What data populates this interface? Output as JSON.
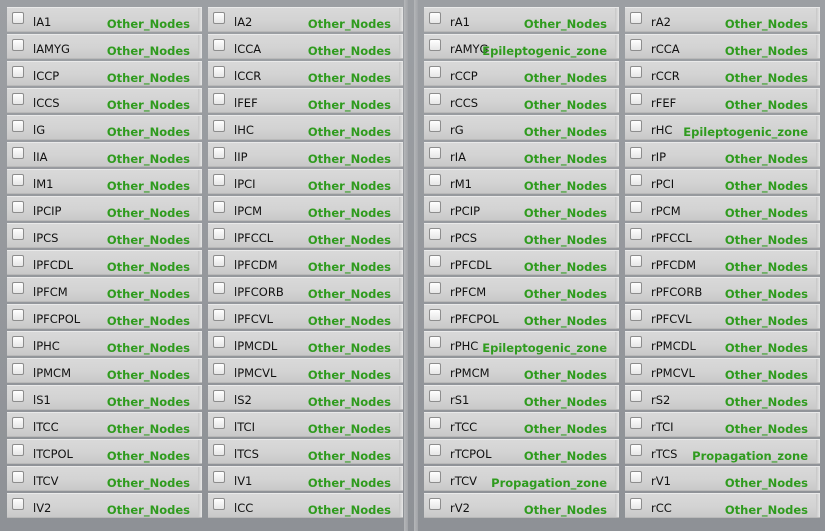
{
  "columns": [
    {
      "rows": [
        {
          "name": "lA1",
          "zone": "Other_Nodes"
        },
        {
          "name": "lAMYG",
          "zone": "Other_Nodes"
        },
        {
          "name": "lCCP",
          "zone": "Other_Nodes"
        },
        {
          "name": "lCCS",
          "zone": "Other_Nodes"
        },
        {
          "name": "lG",
          "zone": "Other_Nodes"
        },
        {
          "name": "lIA",
          "zone": "Other_Nodes"
        },
        {
          "name": "lM1",
          "zone": "Other_Nodes"
        },
        {
          "name": "lPCIP",
          "zone": "Other_Nodes"
        },
        {
          "name": "lPCS",
          "zone": "Other_Nodes"
        },
        {
          "name": "lPFCDL",
          "zone": "Other_Nodes"
        },
        {
          "name": "lPFCM",
          "zone": "Other_Nodes"
        },
        {
          "name": "lPFCPOL",
          "zone": "Other_Nodes"
        },
        {
          "name": "lPHC",
          "zone": "Other_Nodes"
        },
        {
          "name": "lPMCM",
          "zone": "Other_Nodes"
        },
        {
          "name": "lS1",
          "zone": "Other_Nodes"
        },
        {
          "name": "lTCC",
          "zone": "Other_Nodes"
        },
        {
          "name": "lTCPOL",
          "zone": "Other_Nodes"
        },
        {
          "name": "lTCV",
          "zone": "Other_Nodes"
        },
        {
          "name": "lV2",
          "zone": "Other_Nodes"
        }
      ]
    },
    {
      "rows": [
        {
          "name": "lA2",
          "zone": "Other_Nodes"
        },
        {
          "name": "lCCA",
          "zone": "Other_Nodes"
        },
        {
          "name": "lCCR",
          "zone": "Other_Nodes"
        },
        {
          "name": "lFEF",
          "zone": "Other_Nodes"
        },
        {
          "name": "lHC",
          "zone": "Other_Nodes"
        },
        {
          "name": "lIP",
          "zone": "Other_Nodes"
        },
        {
          "name": "lPCI",
          "zone": "Other_Nodes"
        },
        {
          "name": "lPCM",
          "zone": "Other_Nodes"
        },
        {
          "name": "lPFCCL",
          "zone": "Other_Nodes"
        },
        {
          "name": "lPFCDM",
          "zone": "Other_Nodes"
        },
        {
          "name": "lPFCORB",
          "zone": "Other_Nodes"
        },
        {
          "name": "lPFCVL",
          "zone": "Other_Nodes"
        },
        {
          "name": "lPMCDL",
          "zone": "Other_Nodes"
        },
        {
          "name": "lPMCVL",
          "zone": "Other_Nodes"
        },
        {
          "name": "lS2",
          "zone": "Other_Nodes"
        },
        {
          "name": "lTCI",
          "zone": "Other_Nodes"
        },
        {
          "name": "lTCS",
          "zone": "Other_Nodes"
        },
        {
          "name": "lV1",
          "zone": "Other_Nodes"
        },
        {
          "name": "lCC",
          "zone": "Other_Nodes"
        }
      ]
    },
    {
      "rows": [
        {
          "name": "rA1",
          "zone": "Other_Nodes"
        },
        {
          "name": "rAMYG",
          "zone": "Epileptogenic_zone"
        },
        {
          "name": "rCCP",
          "zone": "Other_Nodes"
        },
        {
          "name": "rCCS",
          "zone": "Other_Nodes"
        },
        {
          "name": "rG",
          "zone": "Other_Nodes"
        },
        {
          "name": "rIA",
          "zone": "Other_Nodes"
        },
        {
          "name": "rM1",
          "zone": "Other_Nodes"
        },
        {
          "name": "rPCIP",
          "zone": "Other_Nodes"
        },
        {
          "name": "rPCS",
          "zone": "Other_Nodes"
        },
        {
          "name": "rPFCDL",
          "zone": "Other_Nodes"
        },
        {
          "name": "rPFCM",
          "zone": "Other_Nodes"
        },
        {
          "name": "rPFCPOL",
          "zone": "Other_Nodes"
        },
        {
          "name": "rPHC",
          "zone": "Epileptogenic_zone"
        },
        {
          "name": "rPMCM",
          "zone": "Other_Nodes"
        },
        {
          "name": "rS1",
          "zone": "Other_Nodes"
        },
        {
          "name": "rTCC",
          "zone": "Other_Nodes"
        },
        {
          "name": "rTCPOL",
          "zone": "Other_Nodes"
        },
        {
          "name": "rTCV",
          "zone": "Propagation_zone"
        },
        {
          "name": "rV2",
          "zone": "Other_Nodes"
        }
      ]
    },
    {
      "rows": [
        {
          "name": "rA2",
          "zone": "Other_Nodes"
        },
        {
          "name": "rCCA",
          "zone": "Other_Nodes"
        },
        {
          "name": "rCCR",
          "zone": "Other_Nodes"
        },
        {
          "name": "rFEF",
          "zone": "Other_Nodes"
        },
        {
          "name": "rHC",
          "zone": "Epileptogenic_zone"
        },
        {
          "name": "rIP",
          "zone": "Other_Nodes"
        },
        {
          "name": "rPCI",
          "zone": "Other_Nodes"
        },
        {
          "name": "rPCM",
          "zone": "Other_Nodes"
        },
        {
          "name": "rPFCCL",
          "zone": "Other_Nodes"
        },
        {
          "name": "rPFCDM",
          "zone": "Other_Nodes"
        },
        {
          "name": "rPFCORB",
          "zone": "Other_Nodes"
        },
        {
          "name": "rPFCVL",
          "zone": "Other_Nodes"
        },
        {
          "name": "rPMCDL",
          "zone": "Other_Nodes"
        },
        {
          "name": "rPMCVL",
          "zone": "Other_Nodes"
        },
        {
          "name": "rS2",
          "zone": "Other_Nodes"
        },
        {
          "name": "rTCI",
          "zone": "Other_Nodes"
        },
        {
          "name": "rTCS",
          "zone": "Propagation_zone"
        },
        {
          "name": "rV1",
          "zone": "Other_Nodes"
        },
        {
          "name": "rCC",
          "zone": "Other_Nodes"
        }
      ]
    }
  ],
  "colors": {
    "zone_text": "#2f9b1e",
    "row_bg": "#d3d3d3",
    "page_bg": "#9a9da1"
  }
}
